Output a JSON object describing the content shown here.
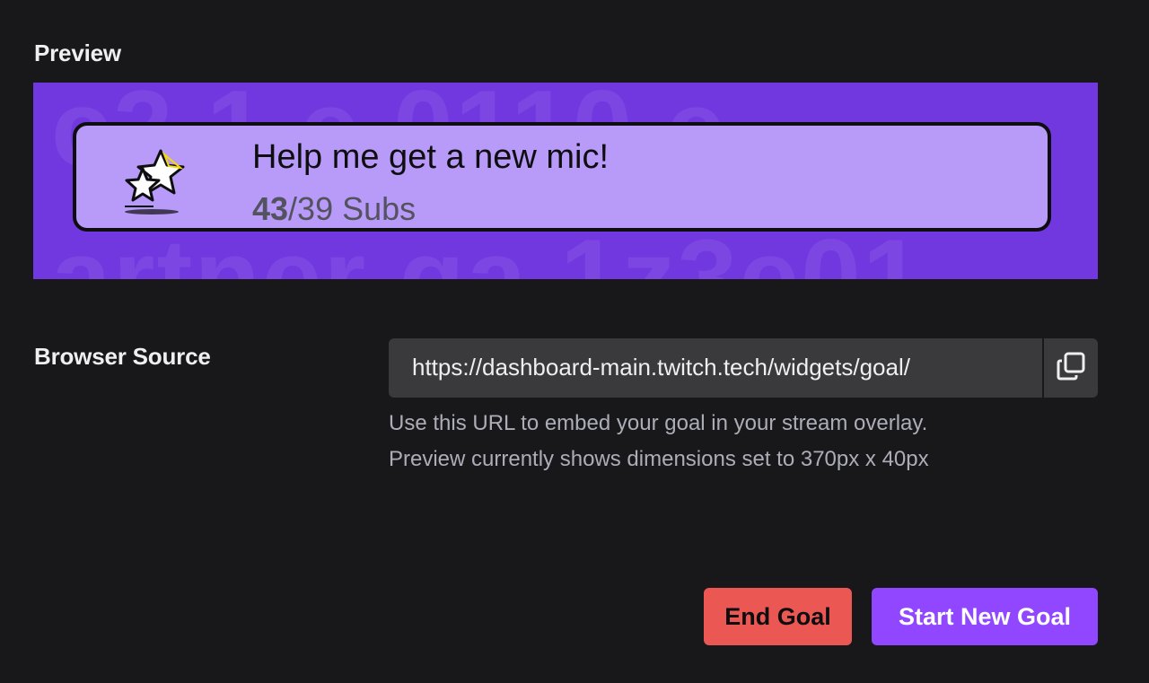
{
  "preview": {
    "section_title": "Preview",
    "goal": {
      "title": "Help me get a new mic!",
      "current": "43",
      "separator_target": "/39 Subs",
      "icon": "stars-icon"
    },
    "colors": {
      "panel_bg": "#7138e0",
      "card_bg": "#b89af8"
    }
  },
  "browser_source": {
    "section_title": "Browser Source",
    "url": "https://dashboard-main.twitch.tech/widgets/goal/",
    "copy_icon": "copy-icon",
    "help_line_1": "Use this URL to embed your goal in your stream overlay.",
    "help_line_2": "Preview currently shows dimensions set to 370px x 40px"
  },
  "actions": {
    "end_goal_label": "End Goal",
    "start_new_goal_label": "Start New Goal",
    "colors": {
      "end": "#eb5753",
      "start": "#9147ff"
    }
  }
}
